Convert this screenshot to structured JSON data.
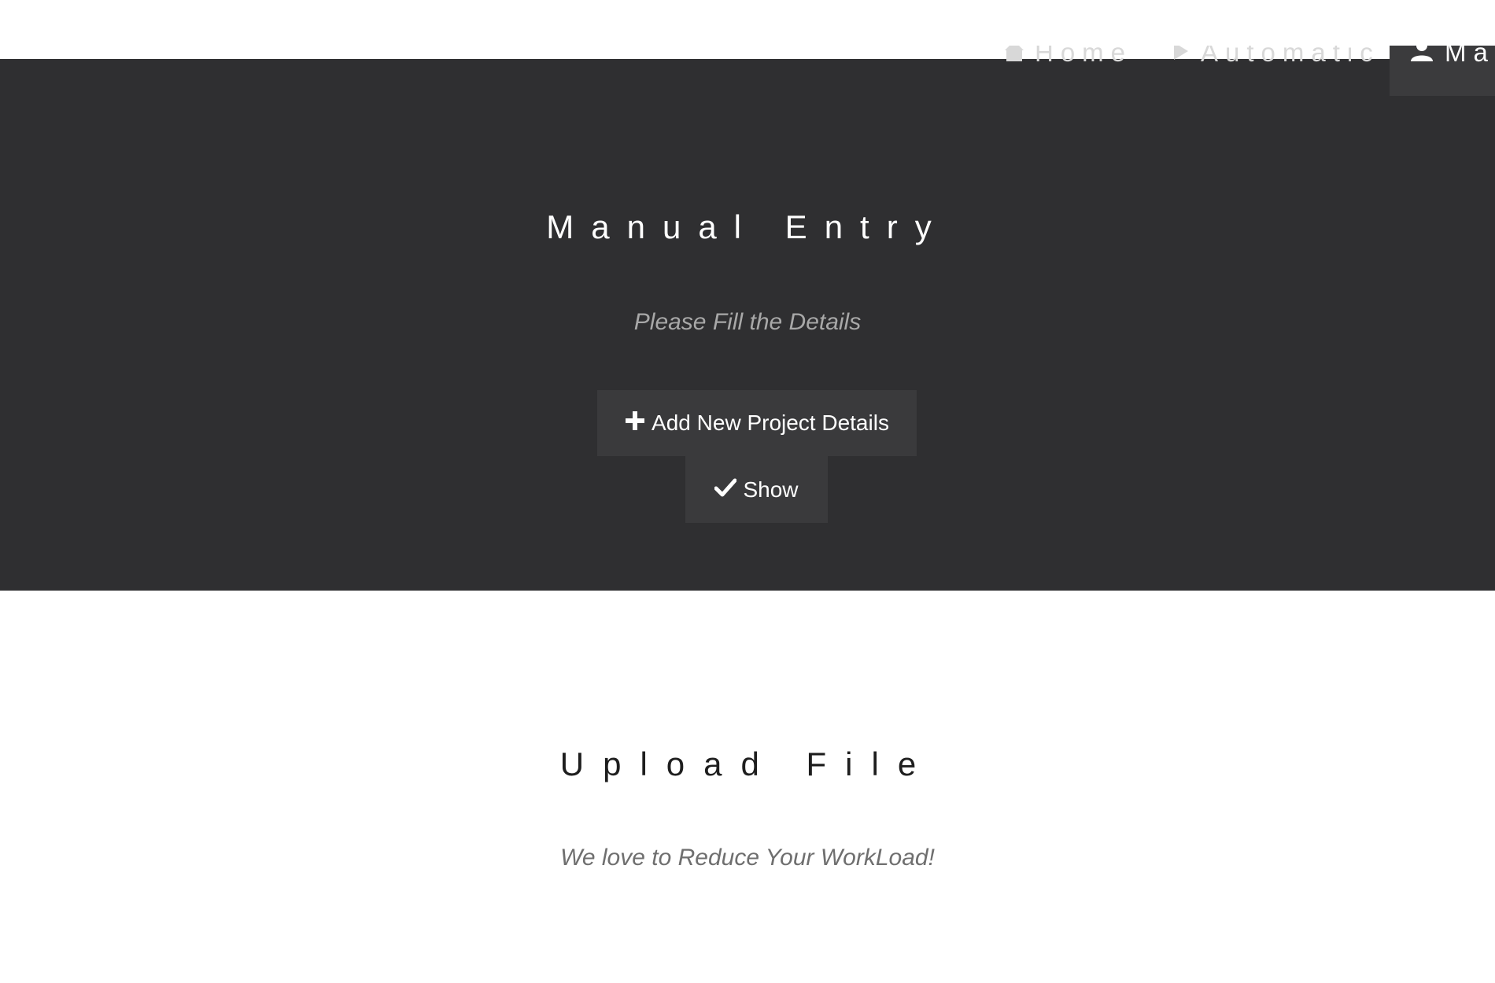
{
  "nav": {
    "home": "Home",
    "automatic": "Automatic",
    "manual": "Manual"
  },
  "manual_section": {
    "title": "Manual Entry",
    "subtitle": "Please Fill the Details",
    "add_button": "Add New Project Details",
    "show_button": "Show"
  },
  "upload_section": {
    "title": "Upload File",
    "subtitle": "We love to Reduce Your WorkLoad!"
  },
  "colors": {
    "dark_band": "#2f2f31",
    "button_bg": "#3a3a3c",
    "light_bg": "#ffffff"
  },
  "icons": {
    "home": "home-icon",
    "automatic": "play-icon",
    "manual": "user-icon",
    "add": "plus-icon",
    "show": "check-icon"
  }
}
